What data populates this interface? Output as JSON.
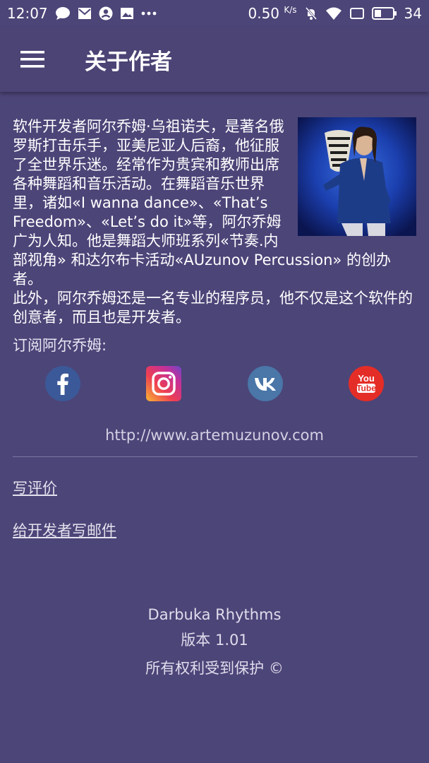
{
  "status": {
    "time": "12:07",
    "speed": "0.50",
    "speed_unit": "K/s",
    "battery": "34",
    "left_icons": [
      "chat-bubble-icon",
      "mail-icon",
      "account-icon",
      "image-icon",
      "more-icon"
    ],
    "right_icons": [
      "mute-icon",
      "wifi-icon",
      "screen-icon",
      "battery-icon"
    ]
  },
  "toolbar": {
    "title": "关于作者",
    "menu_icon": "hamburger-menu-icon"
  },
  "bio": {
    "p1": "软件开发者阿尔乔姆·乌祖诺夫，是著名俄罗斯打击乐手，亚美尼亚人后裔，他征服了全世界乐迷。经常作为贵宾和教师出席各种舞蹈和音乐活动。在舞蹈音乐世界里，诸如«I wanna dance»、«That’s Freedom»、«Let’s do it»等，阿尔乔姆广为人知。他是舞蹈大师班系列«节奏.内部视角» 和达尔布卡活动«AUzunov Percussion» 的创办者。",
    "p2": "此外，阿尔乔姆还是一名专业的程序员，他不仅是这个软件的创意者，而且也是开发者。"
  },
  "subscribe_label": "订阅阿尔乔姆:",
  "social": [
    {
      "name": "facebook-icon",
      "color": "#3b5998"
    },
    {
      "name": "instagram-icon",
      "color": "#e1306c"
    },
    {
      "name": "vk-icon",
      "color": "#4a76a8"
    },
    {
      "name": "youtube-icon",
      "color": "#e52d27"
    }
  ],
  "youtube_text": {
    "you": "You",
    "tube": "Tube"
  },
  "website": "http://www.artemuzunov.com",
  "links": {
    "review": "写评价",
    "email": "给开发者写邮件"
  },
  "footer": {
    "app_name": "Darbuka Rhythms",
    "version": "版本 1.01",
    "rights": "所有权利受到保护 ©"
  },
  "colors": {
    "background": "#4c4578",
    "toolbar": "#4b4475"
  }
}
